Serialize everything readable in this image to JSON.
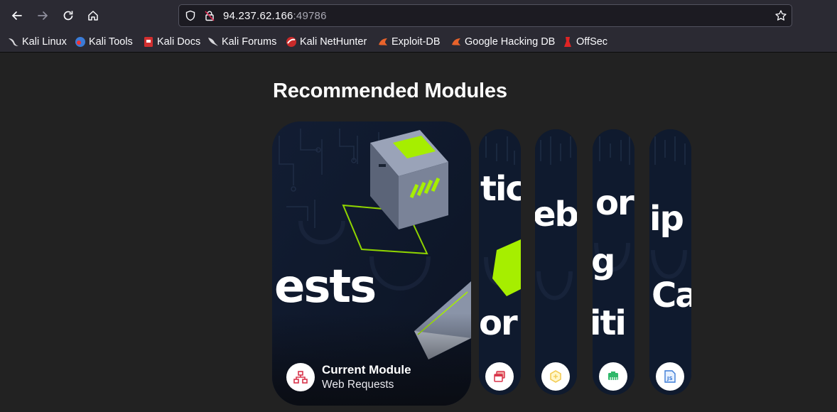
{
  "browser": {
    "url_host": "94.237.62.166",
    "url_port": ":49786",
    "bookmarks": [
      {
        "label": "Kali Linux",
        "icon": "kali-dragon-icon"
      },
      {
        "label": "Kali Tools",
        "icon": "kali-tools-icon"
      },
      {
        "label": "Kali Docs",
        "icon": "kali-docs-icon"
      },
      {
        "label": "Kali Forums",
        "icon": "kali-forums-icon"
      },
      {
        "label": "Kali NetHunter",
        "icon": "nethunter-icon"
      },
      {
        "label": "Exploit-DB",
        "icon": "exploit-db-icon"
      },
      {
        "label": "Google Hacking DB",
        "icon": "ghdb-icon"
      },
      {
        "label": "OffSec",
        "icon": "offsec-icon"
      }
    ]
  },
  "main": {
    "title": "Recommended Modules",
    "current_module": {
      "heading": "Current Module",
      "name": "Web Requests",
      "art_text": "ests",
      "icon": "network-icon"
    },
    "cards": [
      {
        "art_top": "tic",
        "art_bottom": "or",
        "icon": "windows-icon"
      },
      {
        "art_top": "eb",
        "art_bottom": "",
        "icon": "hexagon-icon"
      },
      {
        "art_top": "or",
        "art_mid": "g",
        "art_bottom": "iti",
        "icon": "ethernet-icon"
      },
      {
        "art_top": "ip",
        "art_bottom": "Ca",
        "icon": "js-icon"
      }
    ]
  }
}
